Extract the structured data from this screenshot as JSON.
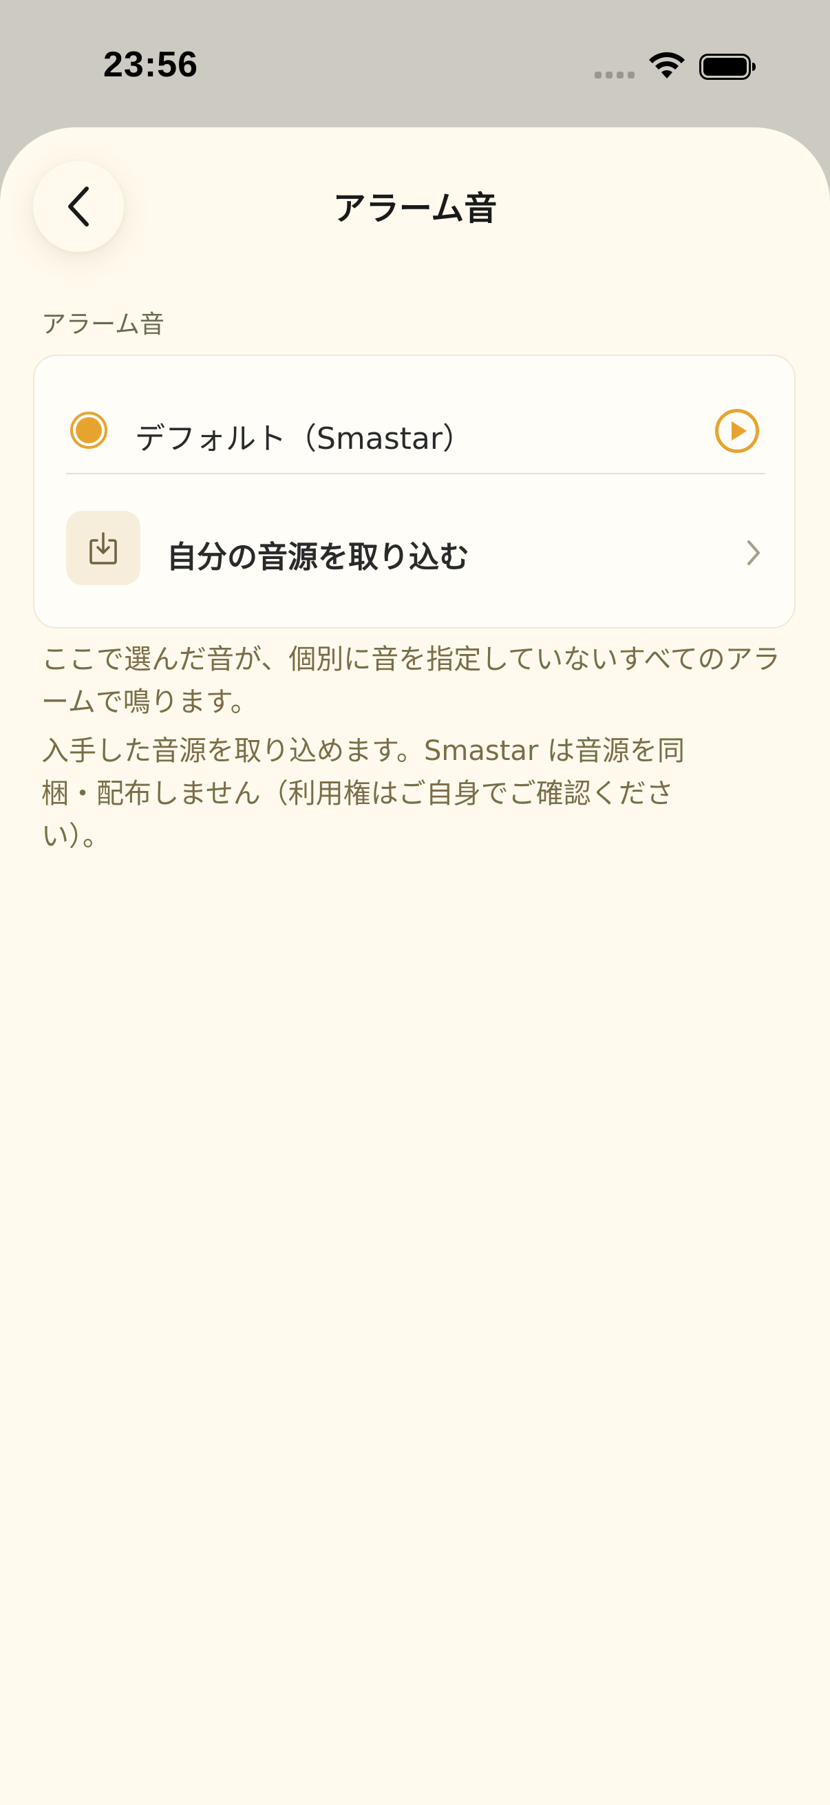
{
  "status_bar": {
    "time": "23:56"
  },
  "header": {
    "title": "アラーム音",
    "back_icon": "chevron-left-icon"
  },
  "section": {
    "label": "アラーム音"
  },
  "sound_options": {
    "default": {
      "label": "デフォルト（Smastar）",
      "selected": true,
      "play_icon": "play-circle-icon"
    },
    "import": {
      "label": "自分の音源を取り込む",
      "icon": "download-icon",
      "chevron_icon": "chevron-right-icon"
    }
  },
  "footnotes": {
    "line1": "ここで選んだ音が、個別に音を指定していないすべてのアラームで鳴ります。",
    "line2": "入手した音源を取り込めます。Smastar は音源を同梱・配布しません（利用権はご自身でご確認ください）。"
  },
  "colors": {
    "accent": "#e6a42f",
    "background": "#fffaed",
    "card": "#fffdf7",
    "footnote_text": "#7a6d48"
  }
}
